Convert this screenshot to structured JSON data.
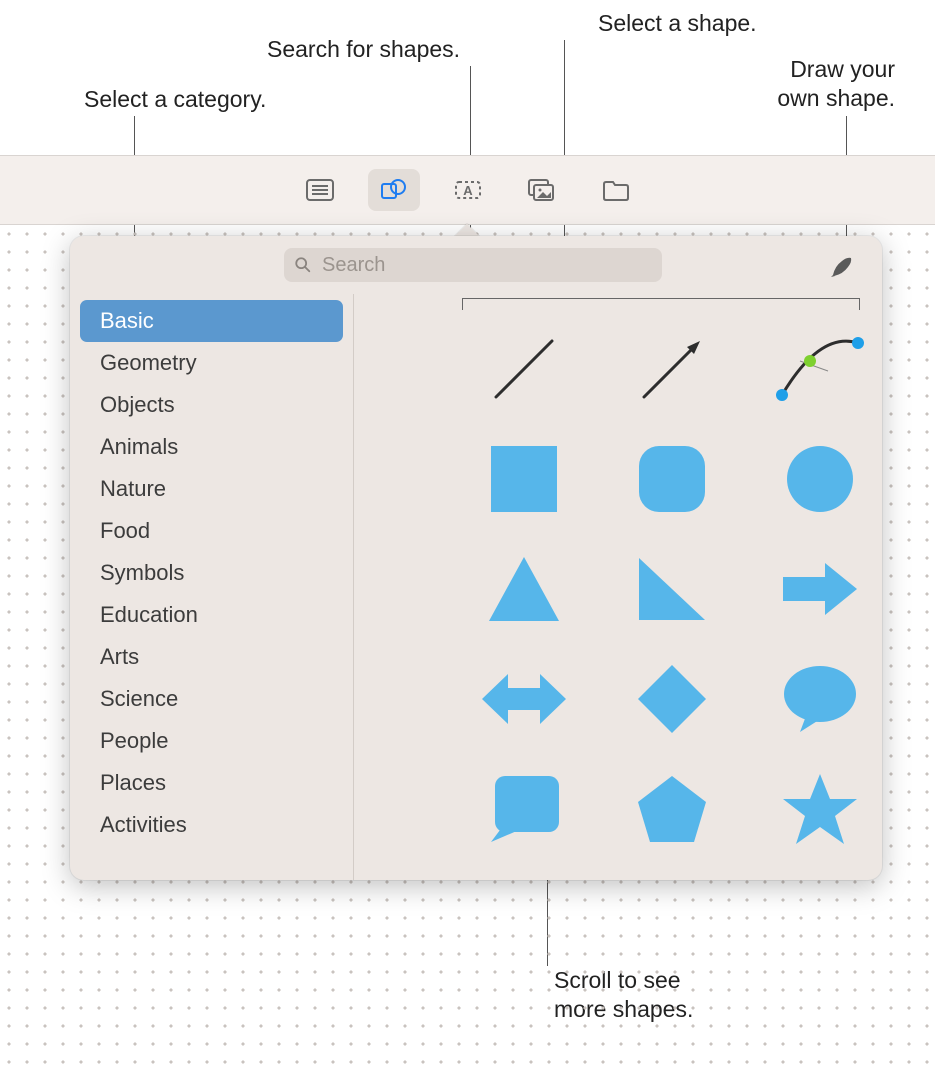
{
  "callouts": {
    "category": "Select a category.",
    "search": "Search for shapes.",
    "select_shape": "Select a shape.",
    "draw": "Draw your\nown shape.",
    "scroll": "Scroll to see\nmore shapes."
  },
  "toolbar": {
    "items": [
      {
        "name": "list-icon"
      },
      {
        "name": "shapes-icon"
      },
      {
        "name": "textbox-icon"
      },
      {
        "name": "media-icon"
      },
      {
        "name": "folder-icon"
      }
    ],
    "active_index": 1
  },
  "search": {
    "placeholder": "Search",
    "value": ""
  },
  "draw_button": {
    "name": "pen-icon"
  },
  "sidebar": {
    "selected_index": 0,
    "items": [
      {
        "label": "Basic"
      },
      {
        "label": "Geometry"
      },
      {
        "label": "Objects"
      },
      {
        "label": "Animals"
      },
      {
        "label": "Nature"
      },
      {
        "label": "Food"
      },
      {
        "label": "Symbols"
      },
      {
        "label": "Education"
      },
      {
        "label": "Arts"
      },
      {
        "label": "Science"
      },
      {
        "label": "People"
      },
      {
        "label": "Places"
      },
      {
        "label": "Activities"
      }
    ]
  },
  "shapes": [
    {
      "name": "line"
    },
    {
      "name": "arrow-line"
    },
    {
      "name": "curve-editor"
    },
    {
      "name": "square"
    },
    {
      "name": "rounded-square"
    },
    {
      "name": "circle"
    },
    {
      "name": "triangle"
    },
    {
      "name": "right-triangle"
    },
    {
      "name": "arrow-right"
    },
    {
      "name": "arrow-left-right"
    },
    {
      "name": "diamond"
    },
    {
      "name": "speech-bubble"
    },
    {
      "name": "callout-box"
    },
    {
      "name": "pentagon"
    },
    {
      "name": "star"
    }
  ],
  "colors": {
    "shape_fill": "#56b6ea",
    "stroke_dark": "#2d2d2d",
    "curve_handle_blue": "#1f9fe8",
    "curve_handle_green": "#7ed02f"
  }
}
